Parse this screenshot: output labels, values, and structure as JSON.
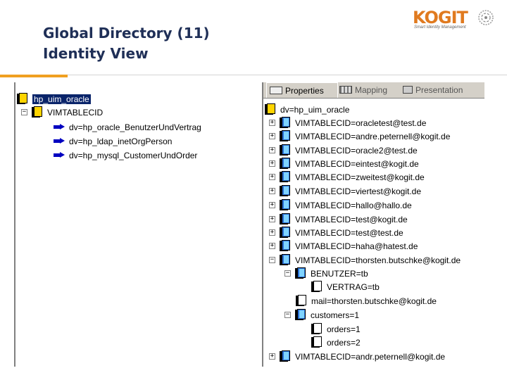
{
  "slide": {
    "title_line1": "Global Directory (11)",
    "title_line2": "Identity View"
  },
  "logo": {
    "name": "KOGIT",
    "tagline": "Smart Identity Management",
    "mark_icon": "gear-swirl-icon"
  },
  "colors": {
    "title": "#1f2f57",
    "accent": "#f0a020",
    "logo": "#e07a1f",
    "selection": "#0a246a"
  },
  "left_tree": {
    "root": "hp_uim_oracle",
    "node": "VIMTABLECID",
    "children": [
      "dv=hp_oracle_BenutzerUndVertrag",
      "dv=hp_ldap_inetOrgPerson",
      "dv=hp_mysql_CustomerUndOrder"
    ]
  },
  "right_panel": {
    "tabs": [
      "Properties",
      "Mapping",
      "Presentation"
    ],
    "root": "dv=hp_uim_oracle",
    "entries": [
      "VIMTABLECID=oracletest@test.de",
      "VIMTABLECID=andre.peternell@kogit.de",
      "VIMTABLECID=oracle2@test.de",
      "VIMTABLECID=eintest@kogit.de",
      "VIMTABLECID=zweitest@kogit.de",
      "VIMTABLECID=viertest@kogit.de",
      "VIMTABLECID=hallo@hallo.de",
      "VIMTABLECID=test@kogit.de",
      "VIMTABLECID=test@test.de",
      "VIMTABLECID=haha@hatest.de",
      "VIMTABLECID=thorsten.butschke@kogit.de"
    ],
    "expanded": {
      "benutzer": "BENUTZER=tb",
      "vertrag": "VERTRAG=tb",
      "mail": "mail=thorsten.butschke@kogit.de",
      "customers": "customers=1",
      "orders": [
        "orders=1",
        "orders=2"
      ]
    },
    "last_entry": "VIMTABLECID=andr.peternell@kogit.de"
  }
}
